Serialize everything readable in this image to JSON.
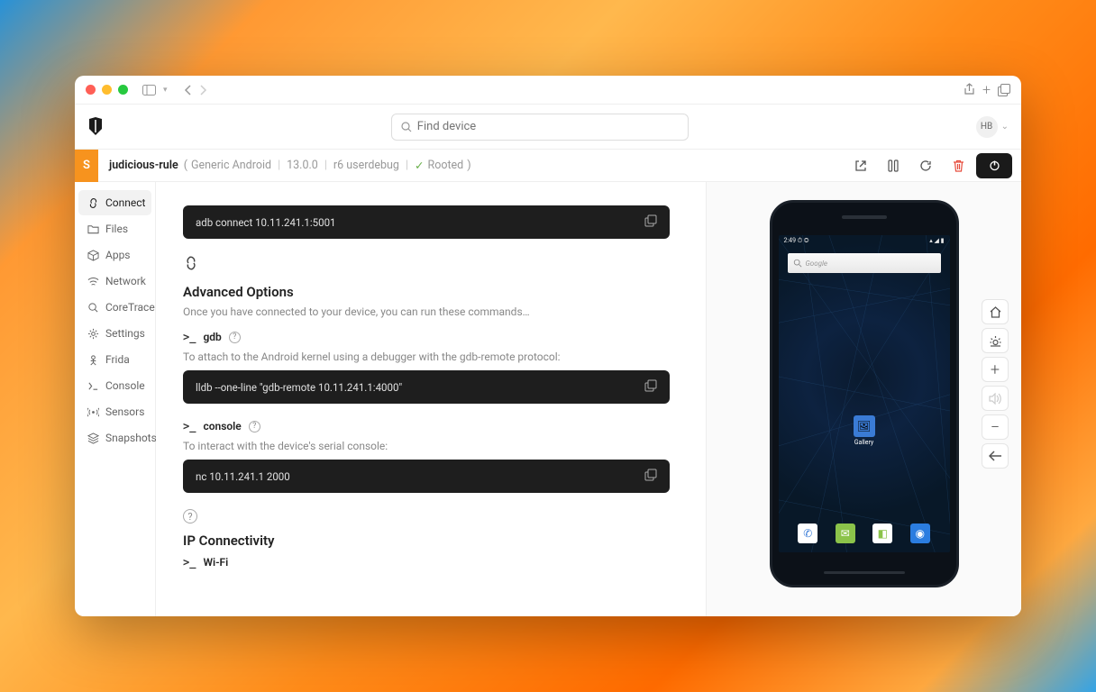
{
  "search": {
    "placeholder": "Find device"
  },
  "user": {
    "initials": "HB"
  },
  "device": {
    "badge": "S",
    "name": "judicious-rule",
    "platform": "Generic Android",
    "version": "13.0.0",
    "build": "r6 userdebug",
    "rooted_label": "Rooted"
  },
  "sidebar": {
    "items": [
      {
        "label": "Connect"
      },
      {
        "label": "Files"
      },
      {
        "label": "Apps"
      },
      {
        "label": "Network"
      },
      {
        "label": "CoreTrace"
      },
      {
        "label": "Settings"
      },
      {
        "label": "Frida"
      },
      {
        "label": "Console"
      },
      {
        "label": "Sensors"
      },
      {
        "label": "Snapshots"
      }
    ]
  },
  "main": {
    "code_adb": "adb connect 10.11.241.1:5001",
    "adv_heading": "Advanced Options",
    "adv_desc": "Once you have connected to your device, you can run these commands…",
    "gdb_label": "gdb",
    "gdb_desc": "To attach to the Android kernel using a debugger with the gdb-remote protocol:",
    "code_lldb": "lldb --one-line \"gdb-remote 10.11.241.1:4000\"",
    "console_label": "console",
    "console_desc": "To interact with the device's serial console:",
    "code_nc": "nc 10.11.241.1 2000",
    "ip_heading": "IP Connectivity",
    "wifi_label": "Wi-Fi"
  },
  "phone": {
    "time": "2:49",
    "search_placeholder": "Google",
    "gallery_label": "Gallery"
  }
}
